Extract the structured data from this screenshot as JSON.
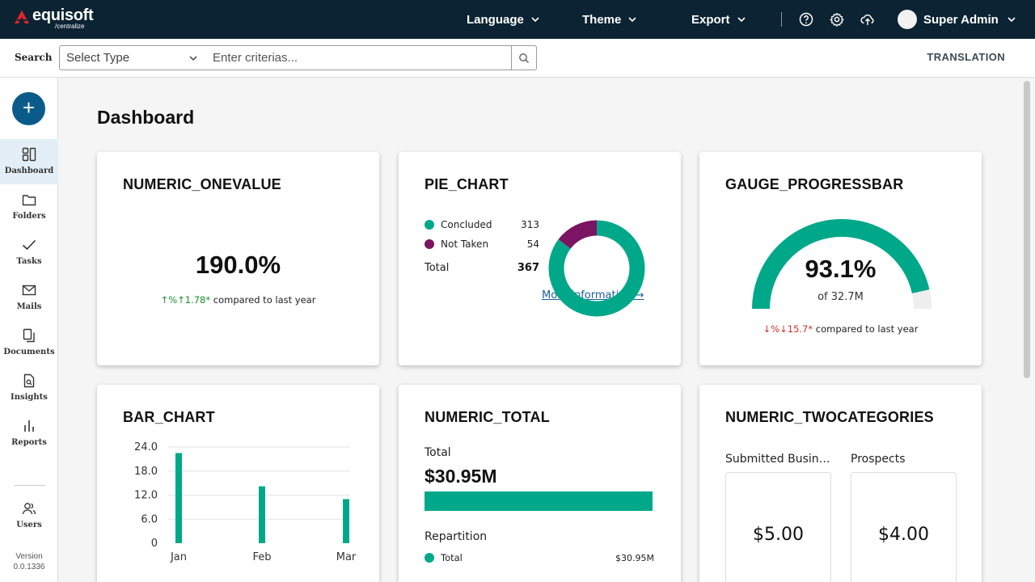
{
  "app": {
    "brand": "equisoft",
    "brand_sub": "/centralize"
  },
  "topbar": {
    "language": "Language",
    "theme": "Theme",
    "export": "Export",
    "user_name": "Super Admin"
  },
  "search": {
    "label": "Search",
    "select_placeholder": "Select Type",
    "criteria_placeholder": "Enter criterias...",
    "translation": "TRANSLATION"
  },
  "sidebar": {
    "items": [
      {
        "label": "Dashboard",
        "icon": "dashboard-icon"
      },
      {
        "label": "Folders",
        "icon": "folder-icon"
      },
      {
        "label": "Tasks",
        "icon": "check-icon"
      },
      {
        "label": "Mails",
        "icon": "mail-icon"
      },
      {
        "label": "Documents",
        "icon": "documents-icon"
      },
      {
        "label": "Insights",
        "icon": "insights-icon"
      },
      {
        "label": "Reports",
        "icon": "reports-icon"
      },
      {
        "label": "Users",
        "icon": "users-icon"
      }
    ],
    "version_label": "Version",
    "version": "0.0.1336"
  },
  "page": {
    "title": "Dashboard"
  },
  "colors": {
    "accent": "#00a88a",
    "secondary": "#7b1462",
    "brand": "#0b2333",
    "up": "#1a8f2e",
    "down": "#d32f2f"
  },
  "cards": {
    "onevalue": {
      "title": "NUMERIC_ONEVALUE",
      "value": "190.0%",
      "delta": "%↑1.78*",
      "compare": "compared to last year"
    },
    "pie": {
      "title": "PIE_CHART",
      "legend": [
        {
          "label": "Concluded",
          "value": "313"
        },
        {
          "label": "Not Taken",
          "value": "54"
        }
      ],
      "total_label": "Total",
      "total_value": "367",
      "more": "More information"
    },
    "gauge": {
      "title": "GAUGE_PROGRESSBAR",
      "value": "93.1%",
      "of": "of 32.7M",
      "delta": "%↓15.7*",
      "compare": "compared to last year",
      "fraction": 0.931
    },
    "bar": {
      "title": "BAR_CHART"
    },
    "total": {
      "title": "NUMERIC_TOTAL",
      "total_label": "Total",
      "amount": "$30.95M",
      "repartition": "Repartition",
      "row_label": "Total",
      "row_value": "$30.95M",
      "fill_fraction": 1.0
    },
    "twocat": {
      "title": "NUMERIC_TWOCATEGORIES",
      "cats": [
        {
          "label": "Submitted Busin…",
          "value": "$5.00"
        },
        {
          "label": "Prospects",
          "value": "$4.00"
        }
      ]
    }
  },
  "chart_data": [
    {
      "type": "pie",
      "labels": [
        "Concluded",
        "Not Taken"
      ],
      "values": [
        313,
        54
      ],
      "colors": [
        "#00a88a",
        "#7b1462"
      ]
    },
    {
      "type": "bar",
      "categories": [
        "Jan",
        "Feb",
        "Mar"
      ],
      "values": [
        22.5,
        14.2,
        11.0
      ],
      "yticks": [
        "24.0",
        "18.0",
        "12.0",
        "6.0",
        "0"
      ],
      "ylim": [
        0,
        24
      ],
      "grid": true,
      "color": "#00a88a"
    }
  ]
}
